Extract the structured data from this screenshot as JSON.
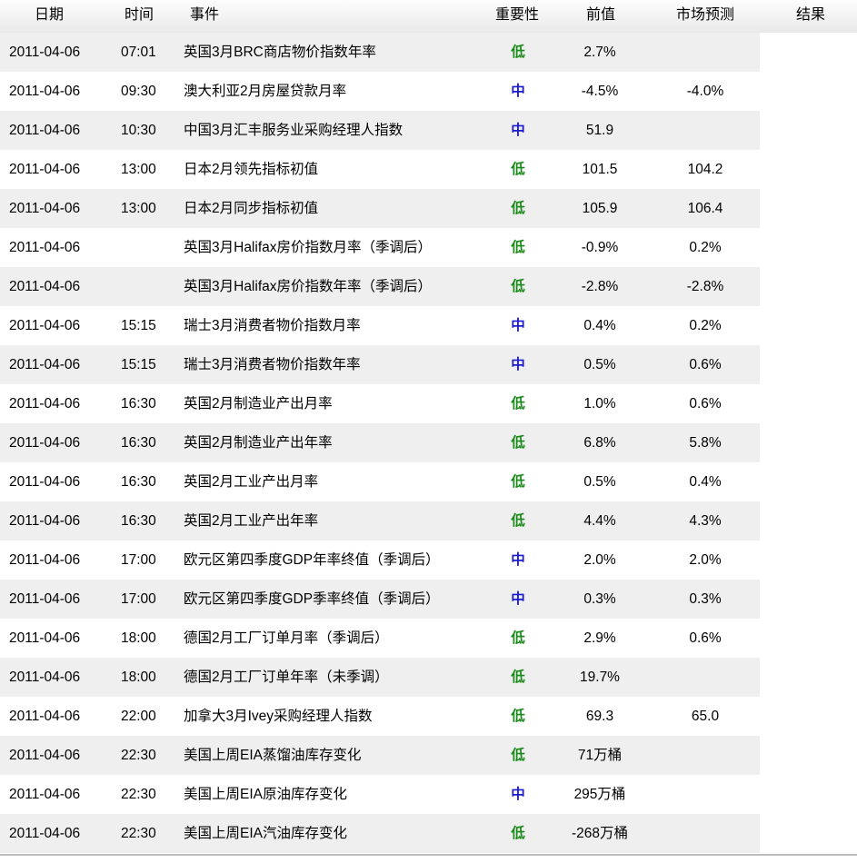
{
  "headers": {
    "date": "日期",
    "time": "时间",
    "event": "事件",
    "importance": "重要性",
    "previous": "前值",
    "forecast": "市场预测",
    "result": "结果"
  },
  "importance_colors": {
    "低": "#1a8a1a",
    "中": "#1a1ad0"
  },
  "rows": [
    {
      "date": "2011-04-06",
      "time": "07:01",
      "event": "英国3月BRC商店物价指数年率",
      "importance": "低",
      "previous": "2.7%",
      "forecast": "",
      "result": ""
    },
    {
      "date": "2011-04-06",
      "time": "09:30",
      "event": "澳大利亚2月房屋贷款月率",
      "importance": "中",
      "previous": "-4.5%",
      "forecast": "-4.0%",
      "result": ""
    },
    {
      "date": "2011-04-06",
      "time": "10:30",
      "event": "中国3月汇丰服务业采购经理人指数",
      "importance": "中",
      "previous": "51.9",
      "forecast": "",
      "result": ""
    },
    {
      "date": "2011-04-06",
      "time": "13:00",
      "event": "日本2月领先指标初值",
      "importance": "低",
      "previous": "101.5",
      "forecast": "104.2",
      "result": ""
    },
    {
      "date": "2011-04-06",
      "time": "13:00",
      "event": "日本2月同步指标初值",
      "importance": "低",
      "previous": "105.9",
      "forecast": "106.4",
      "result": ""
    },
    {
      "date": "2011-04-06",
      "time": "",
      "event": "英国3月Halifax房价指数月率（季调后）",
      "importance": "低",
      "previous": "-0.9%",
      "forecast": "0.2%",
      "result": ""
    },
    {
      "date": "2011-04-06",
      "time": "",
      "event": "英国3月Halifax房价指数年率（季调后）",
      "importance": "低",
      "previous": "-2.8%",
      "forecast": "-2.8%",
      "result": ""
    },
    {
      "date": "2011-04-06",
      "time": "15:15",
      "event": "瑞士3月消费者物价指数月率",
      "importance": "中",
      "previous": "0.4%",
      "forecast": "0.2%",
      "result": ""
    },
    {
      "date": "2011-04-06",
      "time": "15:15",
      "event": "瑞士3月消费者物价指数年率",
      "importance": "中",
      "previous": "0.5%",
      "forecast": "0.6%",
      "result": ""
    },
    {
      "date": "2011-04-06",
      "time": "16:30",
      "event": "英国2月制造业产出月率",
      "importance": "低",
      "previous": "1.0%",
      "forecast": "0.6%",
      "result": ""
    },
    {
      "date": "2011-04-06",
      "time": "16:30",
      "event": "英国2月制造业产出年率",
      "importance": "低",
      "previous": "6.8%",
      "forecast": "5.8%",
      "result": ""
    },
    {
      "date": "2011-04-06",
      "time": "16:30",
      "event": "英国2月工业产出月率",
      "importance": "低",
      "previous": "0.5%",
      "forecast": "0.4%",
      "result": ""
    },
    {
      "date": "2011-04-06",
      "time": "16:30",
      "event": "英国2月工业产出年率",
      "importance": "低",
      "previous": "4.4%",
      "forecast": "4.3%",
      "result": ""
    },
    {
      "date": "2011-04-06",
      "time": "17:00",
      "event": "欧元区第四季度GDP年率终值（季调后）",
      "importance": "中",
      "previous": "2.0%",
      "forecast": "2.0%",
      "result": ""
    },
    {
      "date": "2011-04-06",
      "time": "17:00",
      "event": "欧元区第四季度GDP季率终值（季调后）",
      "importance": "中",
      "previous": "0.3%",
      "forecast": "0.3%",
      "result": ""
    },
    {
      "date": "2011-04-06",
      "time": "18:00",
      "event": "德国2月工厂订单月率（季调后）",
      "importance": "低",
      "previous": "2.9%",
      "forecast": "0.6%",
      "result": ""
    },
    {
      "date": "2011-04-06",
      "time": "18:00",
      "event": "德国2月工厂订单年率（未季调）",
      "importance": "低",
      "previous": "19.7%",
      "forecast": "",
      "result": ""
    },
    {
      "date": "2011-04-06",
      "time": "22:00",
      "event": "加拿大3月Ivey采购经理人指数",
      "importance": "低",
      "previous": "69.3",
      "forecast": "65.0",
      "result": ""
    },
    {
      "date": "2011-04-06",
      "time": "22:30",
      "event": "美国上周EIA蒸馏油库存变化",
      "importance": "低",
      "previous": "71万桶",
      "forecast": "",
      "result": ""
    },
    {
      "date": "2011-04-06",
      "time": "22:30",
      "event": "美国上周EIA原油库存变化",
      "importance": "中",
      "previous": "295万桶",
      "forecast": "",
      "result": ""
    },
    {
      "date": "2011-04-06",
      "time": "22:30",
      "event": "美国上周EIA汽油库存变化",
      "importance": "低",
      "previous": "-268万桶",
      "forecast": "",
      "result": ""
    }
  ]
}
